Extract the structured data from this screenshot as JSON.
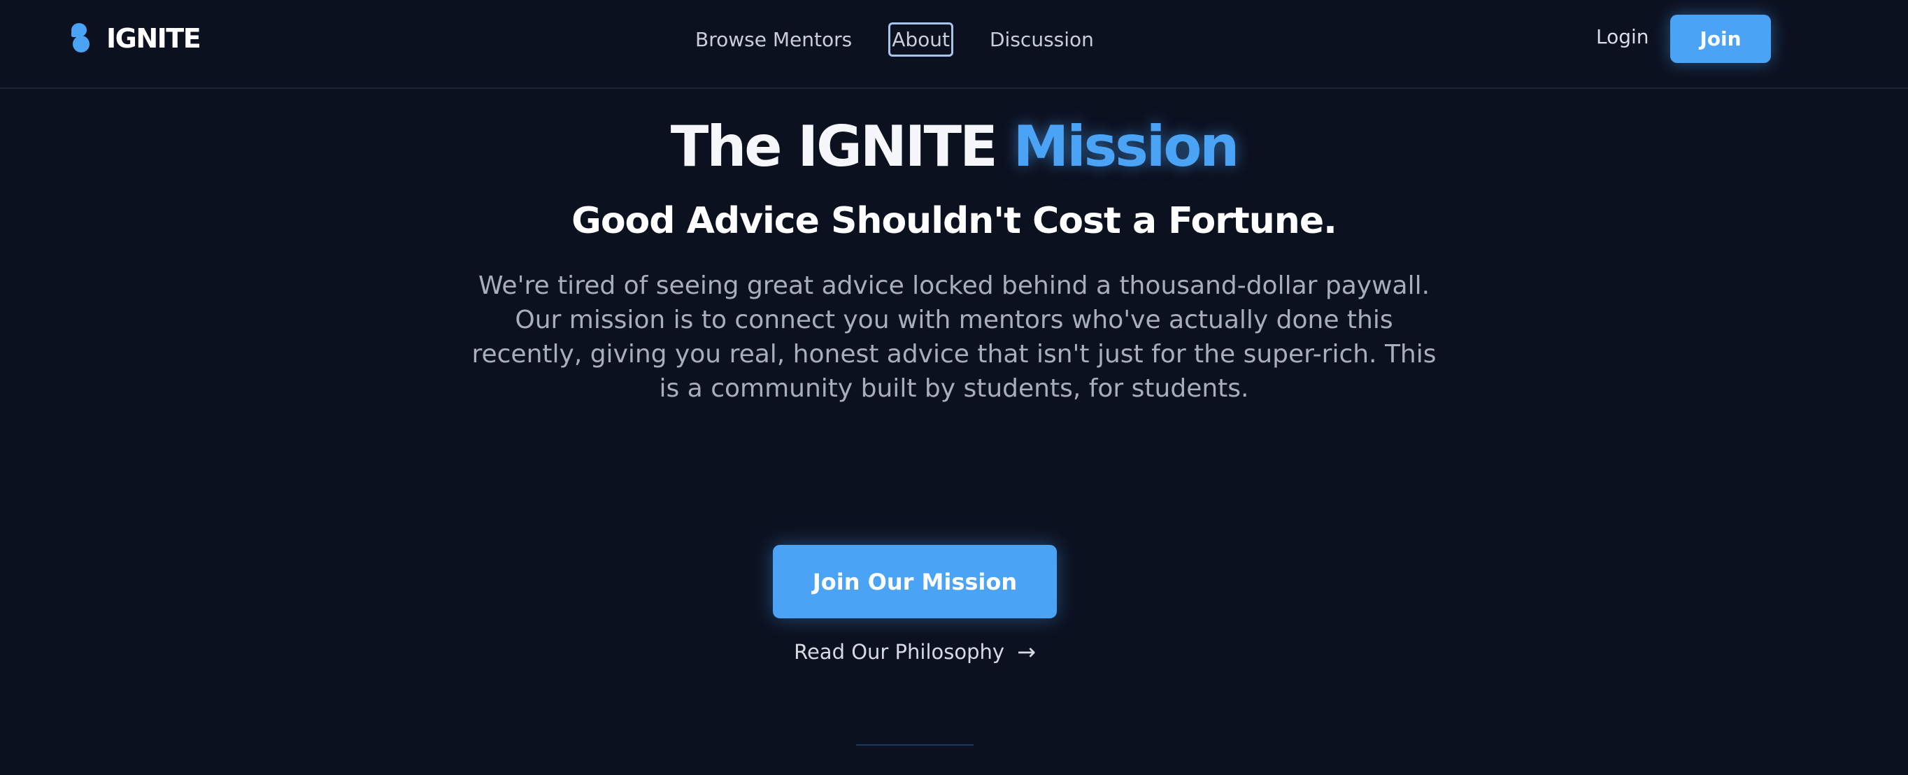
{
  "brand": {
    "name": "IGNITE",
    "accent_color": "#4aa3f5"
  },
  "nav": {
    "links": [
      {
        "label": "Browse Mentors"
      },
      {
        "label": "About"
      },
      {
        "label": "Discussion"
      }
    ],
    "login_label": "Login",
    "join_label": "Join"
  },
  "hero": {
    "title_main": "The IGNITE ",
    "title_accent": "Mission",
    "subtitle": "Good Advice Shouldn't Cost a Fortune.",
    "body_lines": [
      "We're tired of seeing great advice locked behind a thousand-dollar paywall.",
      "Our mission is to connect you with mentors who've actually done this",
      "recently, giving you real, honest advice that isn't just for the super-rich. This",
      "is a community built by students, for students."
    ],
    "cta_label": "Join Our Mission",
    "secondary_link": "Read Our Philosophy",
    "secondary_arrow": "→"
  },
  "colors": {
    "background": "#0c1120",
    "accent": "#4aa3f5",
    "body_text": "#a9aebb"
  },
  "icons": {
    "logo": "ignite-logo-icon",
    "arrow": "arrow-right-icon"
  }
}
